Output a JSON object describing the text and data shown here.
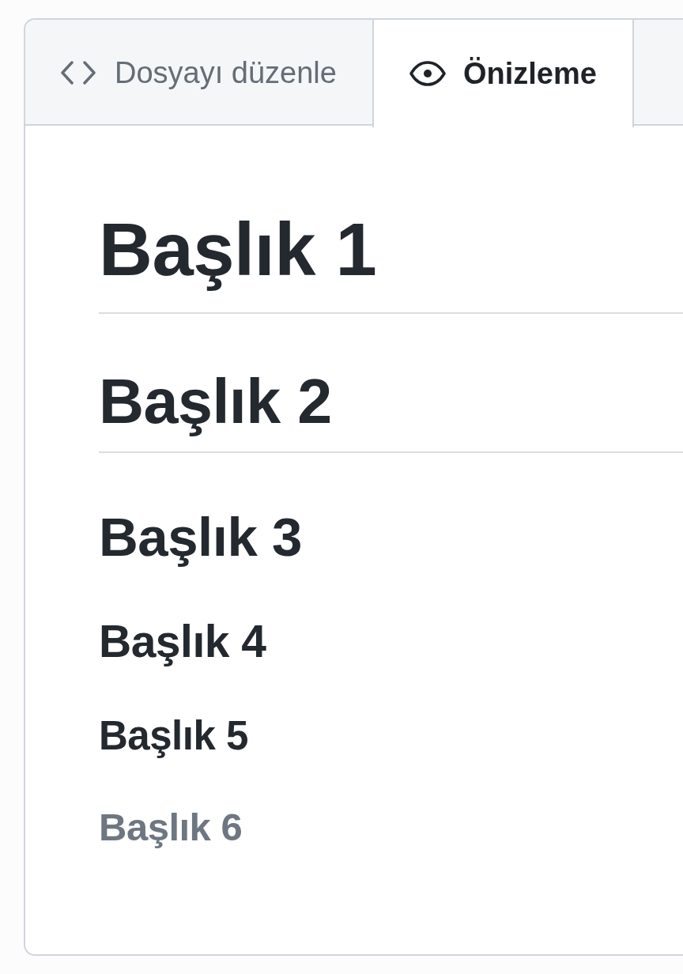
{
  "tabs": [
    {
      "kind": "editor",
      "label": "Dosyayı düzenle",
      "selected": false
    },
    {
      "kind": "preview",
      "label": "Önizleme",
      "selected": true
    }
  ],
  "preview": {
    "headings": [
      {
        "kind": "h1",
        "text": "Başlık 1"
      },
      {
        "kind": "h2",
        "text": "Başlık 2"
      },
      {
        "kind": "h3",
        "text": "Başlık 3"
      },
      {
        "kind": "h4",
        "text": "Başlık 4"
      },
      {
        "kind": "h5",
        "text": "Başlık 5"
      },
      {
        "kind": "h6",
        "text": "Başlık 6"
      }
    ]
  }
}
